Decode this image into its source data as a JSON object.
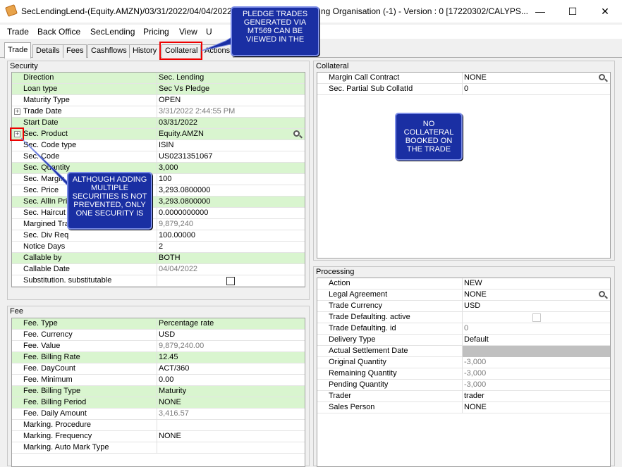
{
  "window": {
    "title_left": "SecLendingLend-(Equity.AMZN)/03/31/2022/04/04/2022",
    "title_right": "ng Organisation  (-1) - Version : 0  [17220302/CALYPS...",
    "minimize": "—",
    "maximize": "☐",
    "close": "✕"
  },
  "menu": [
    "Trade",
    "Back Office",
    "SecLending",
    "Pricing",
    "View",
    "U"
  ],
  "tabs": [
    "Trade",
    "Details",
    "Fees",
    "Cashflows",
    "History",
    "Collateral",
    "Actions"
  ],
  "security": {
    "title": "Security",
    "rows": [
      {
        "label": "Direction",
        "value": "Sec. Lending"
      },
      {
        "label": "Loan type",
        "value": "Sec Vs Pledge"
      },
      {
        "label": "Maturity Type",
        "value": "OPEN"
      },
      {
        "label": "Trade Date",
        "value": "3/31/2022 2:44:55 PM"
      },
      {
        "label": "Start Date",
        "value": "03/31/2022"
      },
      {
        "label": "Sec. Product",
        "value": "Equity.AMZN"
      },
      {
        "label": "Sec. Code type",
        "value": "ISIN"
      },
      {
        "label": "Sec. Code",
        "value": "US0231351067"
      },
      {
        "label": "Sec. Quantity",
        "value": "3,000"
      },
      {
        "label": "Sec. Margin",
        "value": "100"
      },
      {
        "label": "Sec. Price",
        "value": "3,293.0800000"
      },
      {
        "label": "Sec. AllIn Price",
        "value": "3,293.0800000"
      },
      {
        "label": "Sec. Haircut",
        "value": "0.0000000000"
      },
      {
        "label": "Margined Trade",
        "value": "9,879,240"
      },
      {
        "label": "Sec. Div Req",
        "value": "100.00000"
      },
      {
        "label": "Notice Days",
        "value": "2"
      },
      {
        "label": "Callable by",
        "value": "BOTH"
      },
      {
        "label": "Callable Date",
        "value": "04/04/2022"
      },
      {
        "label": "Substitution. substitutable",
        "value": ""
      }
    ]
  },
  "fee": {
    "title": "Fee",
    "rows": [
      {
        "label": "Fee. Type",
        "value": "Percentage rate"
      },
      {
        "label": "Fee. Currency",
        "value": "USD"
      },
      {
        "label": "Fee. Value",
        "value": "9,879,240.00"
      },
      {
        "label": "Fee. Billing Rate",
        "value": "12.45"
      },
      {
        "label": "Fee. DayCount",
        "value": "ACT/360"
      },
      {
        "label": "Fee. Minimum",
        "value": "0.00"
      },
      {
        "label": "Fee. Billing Type",
        "value": "Maturity"
      },
      {
        "label": "Fee. Billing Period",
        "value": "NONE"
      },
      {
        "label": "Fee. Daily Amount",
        "value": "3,416.57"
      },
      {
        "label": "Marking. Procedure",
        "value": ""
      },
      {
        "label": "Marking. Frequency",
        "value": "NONE"
      },
      {
        "label": "Marking. Auto Mark Type",
        "value": ""
      }
    ]
  },
  "collateral": {
    "title": "Collateral",
    "rows": [
      {
        "label": "Margin Call Contract",
        "value": "NONE"
      },
      {
        "label": "Sec. Partial Sub CollatId",
        "value": "0"
      }
    ]
  },
  "processing": {
    "title": "Processing",
    "rows": [
      {
        "label": "Action",
        "value": "NEW"
      },
      {
        "label": "Legal Agreement",
        "value": "NONE"
      },
      {
        "label": "Trade Currency",
        "value": "USD"
      },
      {
        "label": "Trade Defaulting. active",
        "value": ""
      },
      {
        "label": "Trade Defaulting. id",
        "value": "0"
      },
      {
        "label": "Delivery Type",
        "value": "Default"
      },
      {
        "label": "Actual Settlement Date",
        "value": ""
      },
      {
        "label": "Original Quantity",
        "value": "-3,000"
      },
      {
        "label": "Remaining Quantity",
        "value": "-3,000"
      },
      {
        "label": "Pending Quantity",
        "value": "-3,000"
      },
      {
        "label": "Trader",
        "value": "trader"
      },
      {
        "label": "Sales Person",
        "value": "NONE"
      }
    ]
  },
  "callouts": {
    "pledge": "PLEDGE TRADES GENERATED VIA MT569 CAN BE VIEWED IN THE",
    "multiple": "ALTHOUGH ADDING MULTIPLE SECURITIES IS NOT PREVENTED, ONLY ONE SECURITY IS",
    "no_collateral": "NO COLLATERAL BOOKED ON THE TRADE"
  },
  "colors": {
    "highlight_row": "#d9f5cf",
    "callout_bg": "#1a2fa3",
    "annotation_red": "#e00000"
  }
}
